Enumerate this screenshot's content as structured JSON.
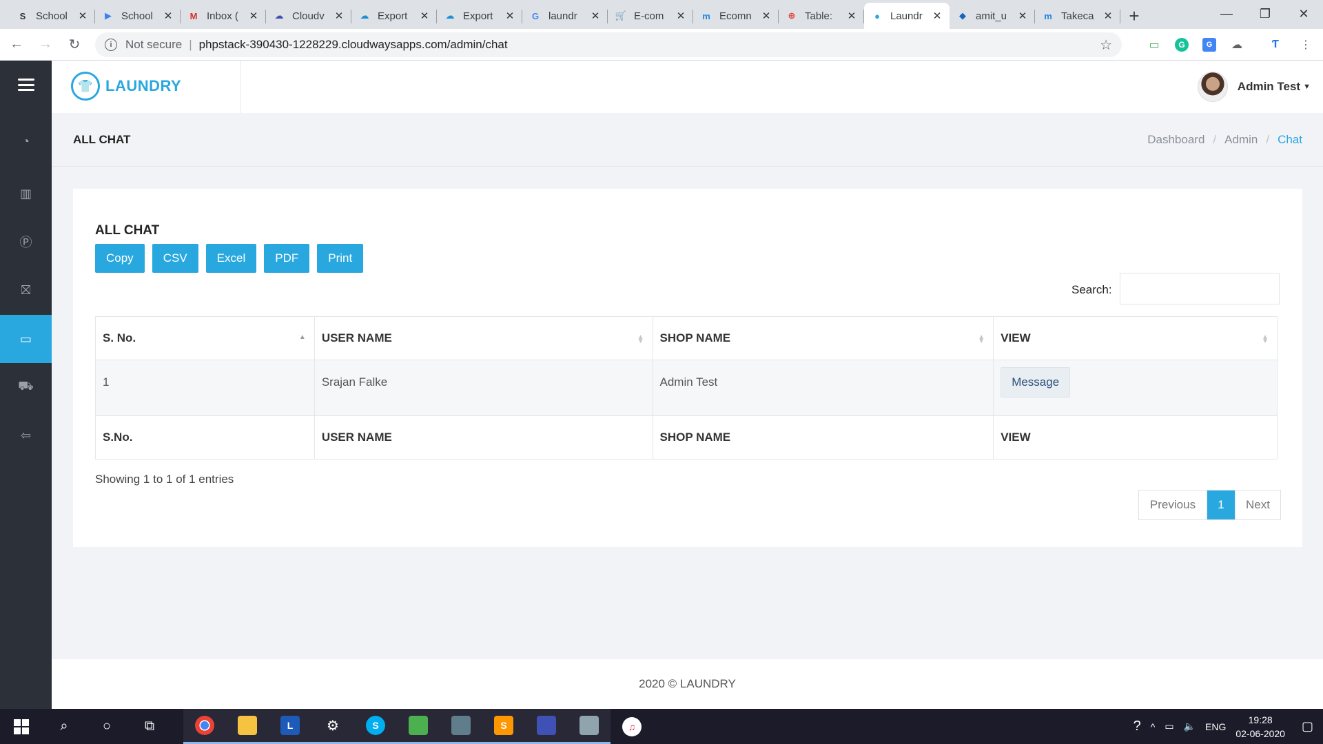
{
  "browser": {
    "tabs": [
      {
        "title": "School",
        "icon_color": "#333333",
        "icon": "S"
      },
      {
        "title": "School",
        "icon_color": "#3b82f6",
        "icon": "▶"
      },
      {
        "title": "Inbox (",
        "icon_color": "#d93025",
        "icon": "M"
      },
      {
        "title": "Cloudv",
        "icon_color": "#3f51b5",
        "icon": "☁"
      },
      {
        "title": "Export",
        "icon_color": "#1a8fd6",
        "icon": "☁"
      },
      {
        "title": "Export",
        "icon_color": "#1a8fd6",
        "icon": "☁"
      },
      {
        "title": "laundr",
        "icon_color": "#4285f4",
        "icon": "G"
      },
      {
        "title": "E-com",
        "icon_color": "#1a8fd6",
        "icon": "🛒"
      },
      {
        "title": "Ecomn",
        "icon_color": "#1e88e5",
        "icon": "m"
      },
      {
        "title": "Table:",
        "icon_color": "#e53935",
        "icon": "⊕"
      },
      {
        "title": "Laundr",
        "icon_color": "#29a8e0",
        "icon": "●",
        "active": true
      },
      {
        "title": "amit_u",
        "icon_color": "#1565c0",
        "icon": "◆"
      },
      {
        "title": "Takeca",
        "icon_color": "#1e88e5",
        "icon": "m"
      }
    ],
    "not_secure": "Not secure",
    "url": "phpstack-390430-1228229.cloudwaysapps.com/admin/chat"
  },
  "app": {
    "logo_text": "LAUNDRY",
    "user_name": "Admin Test"
  },
  "page": {
    "title": "ALL CHAT",
    "breadcrumb": [
      "Dashboard",
      "Admin",
      "Chat"
    ]
  },
  "card": {
    "title": "ALL CHAT",
    "buttons": [
      "Copy",
      "CSV",
      "Excel",
      "PDF",
      "Print"
    ],
    "search_label": "Search:",
    "search_value": "",
    "columns": [
      "S. No.",
      "USER NAME",
      "SHOP NAME",
      "VIEW"
    ],
    "footer_columns": [
      "S.No.",
      "USER NAME",
      "SHOP NAME",
      "VIEW"
    ],
    "rows": [
      {
        "sno": "1",
        "user": "Srajan Falke",
        "shop": "Admin Test",
        "action": "Message"
      }
    ],
    "info": "Showing 1 to 1 of 1 entries",
    "pager": {
      "prev": "Previous",
      "current": "1",
      "next": "Next"
    }
  },
  "footer": {
    "text": "2020 © LAUNDRY"
  },
  "taskbar": {
    "lang": "ENG",
    "time": "19:28",
    "date": "02-06-2020"
  },
  "colors": {
    "accent": "#29a8e0",
    "sidebar": "#2c3038"
  }
}
